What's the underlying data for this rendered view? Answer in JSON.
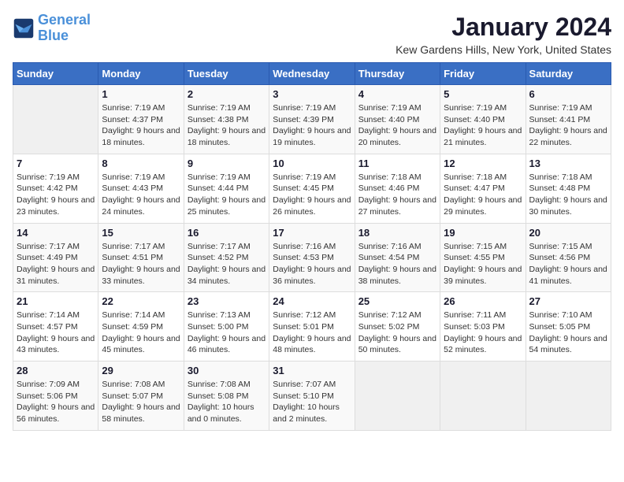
{
  "logo": {
    "line1": "General",
    "line2": "Blue"
  },
  "title": "January 2024",
  "location": "Kew Gardens Hills, New York, United States",
  "days_of_week": [
    "Sunday",
    "Monday",
    "Tuesday",
    "Wednesday",
    "Thursday",
    "Friday",
    "Saturday"
  ],
  "weeks": [
    [
      {
        "num": "",
        "sunrise": "",
        "sunset": "",
        "daylight": ""
      },
      {
        "num": "1",
        "sunrise": "Sunrise: 7:19 AM",
        "sunset": "Sunset: 4:37 PM",
        "daylight": "Daylight: 9 hours and 18 minutes."
      },
      {
        "num": "2",
        "sunrise": "Sunrise: 7:19 AM",
        "sunset": "Sunset: 4:38 PM",
        "daylight": "Daylight: 9 hours and 18 minutes."
      },
      {
        "num": "3",
        "sunrise": "Sunrise: 7:19 AM",
        "sunset": "Sunset: 4:39 PM",
        "daylight": "Daylight: 9 hours and 19 minutes."
      },
      {
        "num": "4",
        "sunrise": "Sunrise: 7:19 AM",
        "sunset": "Sunset: 4:40 PM",
        "daylight": "Daylight: 9 hours and 20 minutes."
      },
      {
        "num": "5",
        "sunrise": "Sunrise: 7:19 AM",
        "sunset": "Sunset: 4:40 PM",
        "daylight": "Daylight: 9 hours and 21 minutes."
      },
      {
        "num": "6",
        "sunrise": "Sunrise: 7:19 AM",
        "sunset": "Sunset: 4:41 PM",
        "daylight": "Daylight: 9 hours and 22 minutes."
      }
    ],
    [
      {
        "num": "7",
        "sunrise": "Sunrise: 7:19 AM",
        "sunset": "Sunset: 4:42 PM",
        "daylight": "Daylight: 9 hours and 23 minutes."
      },
      {
        "num": "8",
        "sunrise": "Sunrise: 7:19 AM",
        "sunset": "Sunset: 4:43 PM",
        "daylight": "Daylight: 9 hours and 24 minutes."
      },
      {
        "num": "9",
        "sunrise": "Sunrise: 7:19 AM",
        "sunset": "Sunset: 4:44 PM",
        "daylight": "Daylight: 9 hours and 25 minutes."
      },
      {
        "num": "10",
        "sunrise": "Sunrise: 7:19 AM",
        "sunset": "Sunset: 4:45 PM",
        "daylight": "Daylight: 9 hours and 26 minutes."
      },
      {
        "num": "11",
        "sunrise": "Sunrise: 7:18 AM",
        "sunset": "Sunset: 4:46 PM",
        "daylight": "Daylight: 9 hours and 27 minutes."
      },
      {
        "num": "12",
        "sunrise": "Sunrise: 7:18 AM",
        "sunset": "Sunset: 4:47 PM",
        "daylight": "Daylight: 9 hours and 29 minutes."
      },
      {
        "num": "13",
        "sunrise": "Sunrise: 7:18 AM",
        "sunset": "Sunset: 4:48 PM",
        "daylight": "Daylight: 9 hours and 30 minutes."
      }
    ],
    [
      {
        "num": "14",
        "sunrise": "Sunrise: 7:17 AM",
        "sunset": "Sunset: 4:49 PM",
        "daylight": "Daylight: 9 hours and 31 minutes."
      },
      {
        "num": "15",
        "sunrise": "Sunrise: 7:17 AM",
        "sunset": "Sunset: 4:51 PM",
        "daylight": "Daylight: 9 hours and 33 minutes."
      },
      {
        "num": "16",
        "sunrise": "Sunrise: 7:17 AM",
        "sunset": "Sunset: 4:52 PM",
        "daylight": "Daylight: 9 hours and 34 minutes."
      },
      {
        "num": "17",
        "sunrise": "Sunrise: 7:16 AM",
        "sunset": "Sunset: 4:53 PM",
        "daylight": "Daylight: 9 hours and 36 minutes."
      },
      {
        "num": "18",
        "sunrise": "Sunrise: 7:16 AM",
        "sunset": "Sunset: 4:54 PM",
        "daylight": "Daylight: 9 hours and 38 minutes."
      },
      {
        "num": "19",
        "sunrise": "Sunrise: 7:15 AM",
        "sunset": "Sunset: 4:55 PM",
        "daylight": "Daylight: 9 hours and 39 minutes."
      },
      {
        "num": "20",
        "sunrise": "Sunrise: 7:15 AM",
        "sunset": "Sunset: 4:56 PM",
        "daylight": "Daylight: 9 hours and 41 minutes."
      }
    ],
    [
      {
        "num": "21",
        "sunrise": "Sunrise: 7:14 AM",
        "sunset": "Sunset: 4:57 PM",
        "daylight": "Daylight: 9 hours and 43 minutes."
      },
      {
        "num": "22",
        "sunrise": "Sunrise: 7:14 AM",
        "sunset": "Sunset: 4:59 PM",
        "daylight": "Daylight: 9 hours and 45 minutes."
      },
      {
        "num": "23",
        "sunrise": "Sunrise: 7:13 AM",
        "sunset": "Sunset: 5:00 PM",
        "daylight": "Daylight: 9 hours and 46 minutes."
      },
      {
        "num": "24",
        "sunrise": "Sunrise: 7:12 AM",
        "sunset": "Sunset: 5:01 PM",
        "daylight": "Daylight: 9 hours and 48 minutes."
      },
      {
        "num": "25",
        "sunrise": "Sunrise: 7:12 AM",
        "sunset": "Sunset: 5:02 PM",
        "daylight": "Daylight: 9 hours and 50 minutes."
      },
      {
        "num": "26",
        "sunrise": "Sunrise: 7:11 AM",
        "sunset": "Sunset: 5:03 PM",
        "daylight": "Daylight: 9 hours and 52 minutes."
      },
      {
        "num": "27",
        "sunrise": "Sunrise: 7:10 AM",
        "sunset": "Sunset: 5:05 PM",
        "daylight": "Daylight: 9 hours and 54 minutes."
      }
    ],
    [
      {
        "num": "28",
        "sunrise": "Sunrise: 7:09 AM",
        "sunset": "Sunset: 5:06 PM",
        "daylight": "Daylight: 9 hours and 56 minutes."
      },
      {
        "num": "29",
        "sunrise": "Sunrise: 7:08 AM",
        "sunset": "Sunset: 5:07 PM",
        "daylight": "Daylight: 9 hours and 58 minutes."
      },
      {
        "num": "30",
        "sunrise": "Sunrise: 7:08 AM",
        "sunset": "Sunset: 5:08 PM",
        "daylight": "Daylight: 10 hours and 0 minutes."
      },
      {
        "num": "31",
        "sunrise": "Sunrise: 7:07 AM",
        "sunset": "Sunset: 5:10 PM",
        "daylight": "Daylight: 10 hours and 2 minutes."
      },
      {
        "num": "",
        "sunrise": "",
        "sunset": "",
        "daylight": ""
      },
      {
        "num": "",
        "sunrise": "",
        "sunset": "",
        "daylight": ""
      },
      {
        "num": "",
        "sunrise": "",
        "sunset": "",
        "daylight": ""
      }
    ]
  ]
}
